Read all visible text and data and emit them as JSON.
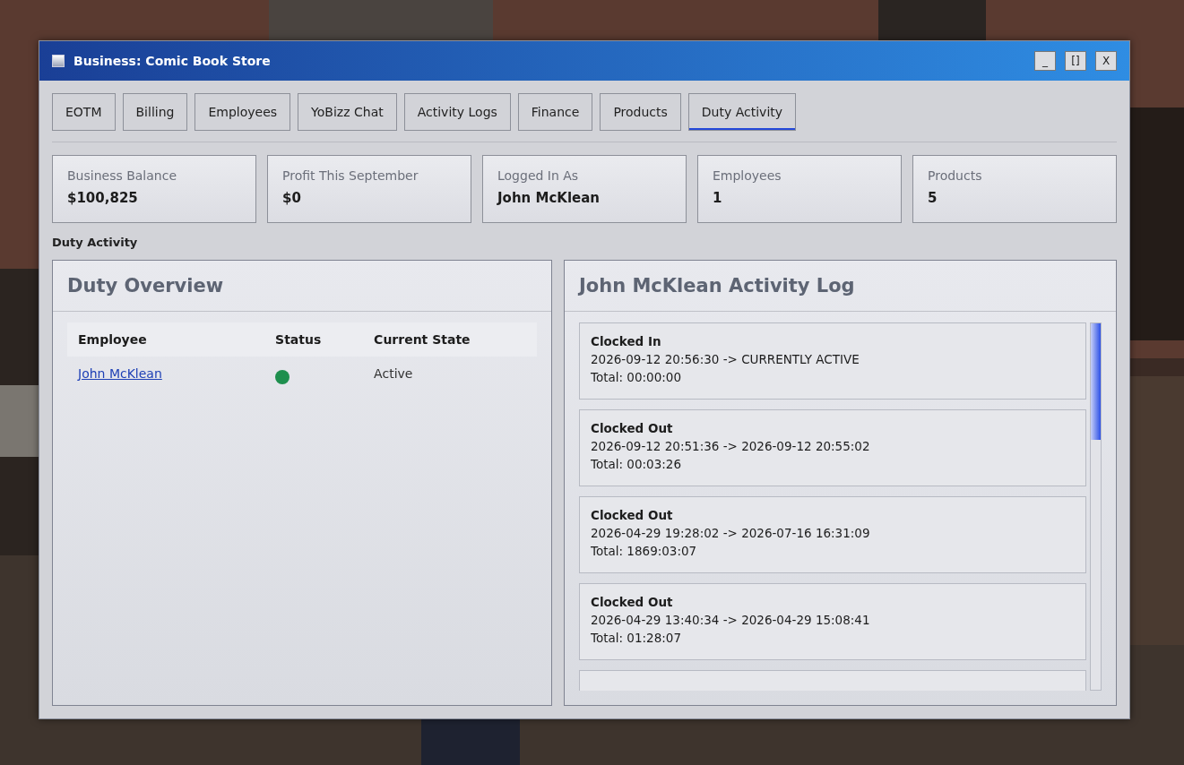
{
  "window": {
    "title": "Business: Comic Book Store",
    "controls": [
      "_",
      "[]",
      "X"
    ]
  },
  "tabs": [
    {
      "label": "EOTM",
      "selected": false
    },
    {
      "label": "Billing",
      "selected": false
    },
    {
      "label": "Employees",
      "selected": false
    },
    {
      "label": "YoBizz Chat",
      "selected": false
    },
    {
      "label": "Activity Logs",
      "selected": false
    },
    {
      "label": "Finance",
      "selected": false
    },
    {
      "label": "Products",
      "selected": false
    },
    {
      "label": "Duty Activity",
      "selected": true
    }
  ],
  "stats": [
    {
      "label": "Business Balance",
      "value": "$100,825"
    },
    {
      "label": "Profit This September",
      "value": "$0"
    },
    {
      "label": "Logged In As",
      "value": "John McKlean"
    },
    {
      "label": "Employees",
      "value": "1"
    },
    {
      "label": "Products",
      "value": "5"
    }
  ],
  "section_title": "Duty Activity",
  "overview": {
    "title": "Duty Overview",
    "columns": [
      "Employee",
      "Status",
      "Current State"
    ],
    "rows": [
      {
        "employee": "John McKlean",
        "color": "#1e8f4e",
        "state": "Active"
      }
    ]
  },
  "log": {
    "title": "John McKlean Activity Log",
    "entries": [
      {
        "title": "Clocked In",
        "range": "2026-09-12 20:56:30 -> CURRENTLY ACTIVE",
        "total": "Total: 00:00:00"
      },
      {
        "title": "Clocked Out",
        "range": "2026-09-12 20:51:36 -> 2026-09-12 20:55:02",
        "total": "Total: 00:03:26"
      },
      {
        "title": "Clocked Out",
        "range": "2026-04-29 19:28:02 -> 2026-07-16 16:31:09",
        "total": "Total: 1869:03:07"
      },
      {
        "title": "Clocked Out",
        "range": "2026-04-29 13:40:34 -> 2026-04-29 15:08:41",
        "total": "Total: 01:28:07"
      }
    ]
  }
}
